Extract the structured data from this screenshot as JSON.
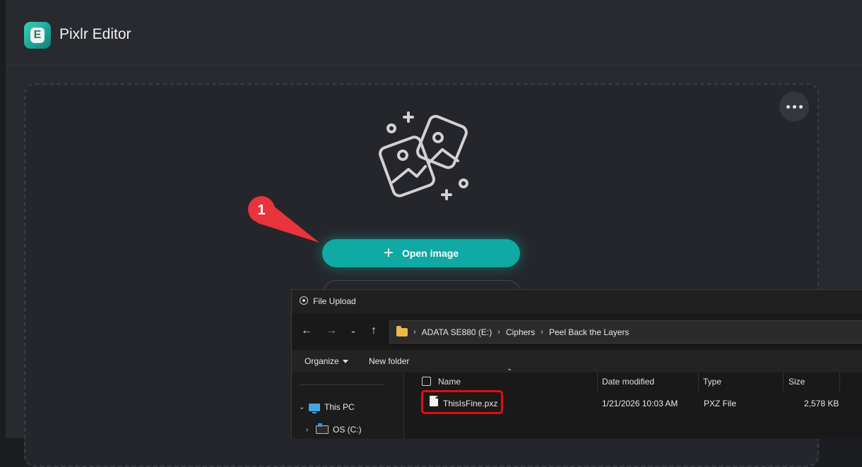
{
  "app": {
    "title": "Pixlr Editor",
    "logo_letter": "E",
    "open_image_label": "Open image",
    "annotation_number": "1",
    "accent_color": "#10a9a3",
    "annotation_color": "#e8343b"
  },
  "dialog": {
    "title": "File Upload",
    "breadcrumb": [
      "ADATA SE880 (E:)",
      "Ciphers",
      "Peel Back the Layers"
    ],
    "commands": {
      "organize": "Organize",
      "new_folder": "New folder"
    },
    "nav_tree": [
      {
        "label": "This PC",
        "icon": "pc-icon",
        "expanded": true
      },
      {
        "label": "OS (C:)",
        "icon": "drive-icon",
        "expanded": false
      }
    ],
    "columns": [
      "Name",
      "Date modified",
      "Type",
      "Size"
    ],
    "files": [
      {
        "name": "ThisIsFine.pxz",
        "date_modified": "1/21/2026 10:03 AM",
        "type": "PXZ File",
        "size": "2,578 KB",
        "highlighted": true
      }
    ]
  }
}
